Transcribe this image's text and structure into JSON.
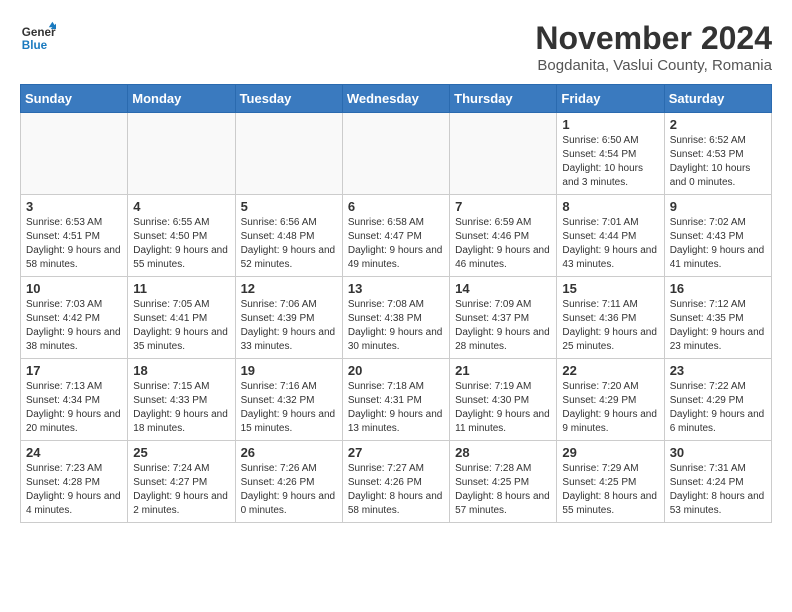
{
  "header": {
    "logo_line1": "General",
    "logo_line2": "Blue",
    "month_title": "November 2024",
    "location": "Bogdanita, Vaslui County, Romania"
  },
  "weekdays": [
    "Sunday",
    "Monday",
    "Tuesday",
    "Wednesday",
    "Thursday",
    "Friday",
    "Saturday"
  ],
  "weeks": [
    [
      {
        "day": "",
        "info": ""
      },
      {
        "day": "",
        "info": ""
      },
      {
        "day": "",
        "info": ""
      },
      {
        "day": "",
        "info": ""
      },
      {
        "day": "",
        "info": ""
      },
      {
        "day": "1",
        "info": "Sunrise: 6:50 AM\nSunset: 4:54 PM\nDaylight: 10 hours and 3 minutes."
      },
      {
        "day": "2",
        "info": "Sunrise: 6:52 AM\nSunset: 4:53 PM\nDaylight: 10 hours and 0 minutes."
      }
    ],
    [
      {
        "day": "3",
        "info": "Sunrise: 6:53 AM\nSunset: 4:51 PM\nDaylight: 9 hours and 58 minutes."
      },
      {
        "day": "4",
        "info": "Sunrise: 6:55 AM\nSunset: 4:50 PM\nDaylight: 9 hours and 55 minutes."
      },
      {
        "day": "5",
        "info": "Sunrise: 6:56 AM\nSunset: 4:48 PM\nDaylight: 9 hours and 52 minutes."
      },
      {
        "day": "6",
        "info": "Sunrise: 6:58 AM\nSunset: 4:47 PM\nDaylight: 9 hours and 49 minutes."
      },
      {
        "day": "7",
        "info": "Sunrise: 6:59 AM\nSunset: 4:46 PM\nDaylight: 9 hours and 46 minutes."
      },
      {
        "day": "8",
        "info": "Sunrise: 7:01 AM\nSunset: 4:44 PM\nDaylight: 9 hours and 43 minutes."
      },
      {
        "day": "9",
        "info": "Sunrise: 7:02 AM\nSunset: 4:43 PM\nDaylight: 9 hours and 41 minutes."
      }
    ],
    [
      {
        "day": "10",
        "info": "Sunrise: 7:03 AM\nSunset: 4:42 PM\nDaylight: 9 hours and 38 minutes."
      },
      {
        "day": "11",
        "info": "Sunrise: 7:05 AM\nSunset: 4:41 PM\nDaylight: 9 hours and 35 minutes."
      },
      {
        "day": "12",
        "info": "Sunrise: 7:06 AM\nSunset: 4:39 PM\nDaylight: 9 hours and 33 minutes."
      },
      {
        "day": "13",
        "info": "Sunrise: 7:08 AM\nSunset: 4:38 PM\nDaylight: 9 hours and 30 minutes."
      },
      {
        "day": "14",
        "info": "Sunrise: 7:09 AM\nSunset: 4:37 PM\nDaylight: 9 hours and 28 minutes."
      },
      {
        "day": "15",
        "info": "Sunrise: 7:11 AM\nSunset: 4:36 PM\nDaylight: 9 hours and 25 minutes."
      },
      {
        "day": "16",
        "info": "Sunrise: 7:12 AM\nSunset: 4:35 PM\nDaylight: 9 hours and 23 minutes."
      }
    ],
    [
      {
        "day": "17",
        "info": "Sunrise: 7:13 AM\nSunset: 4:34 PM\nDaylight: 9 hours and 20 minutes."
      },
      {
        "day": "18",
        "info": "Sunrise: 7:15 AM\nSunset: 4:33 PM\nDaylight: 9 hours and 18 minutes."
      },
      {
        "day": "19",
        "info": "Sunrise: 7:16 AM\nSunset: 4:32 PM\nDaylight: 9 hours and 15 minutes."
      },
      {
        "day": "20",
        "info": "Sunrise: 7:18 AM\nSunset: 4:31 PM\nDaylight: 9 hours and 13 minutes."
      },
      {
        "day": "21",
        "info": "Sunrise: 7:19 AM\nSunset: 4:30 PM\nDaylight: 9 hours and 11 minutes."
      },
      {
        "day": "22",
        "info": "Sunrise: 7:20 AM\nSunset: 4:29 PM\nDaylight: 9 hours and 9 minutes."
      },
      {
        "day": "23",
        "info": "Sunrise: 7:22 AM\nSunset: 4:29 PM\nDaylight: 9 hours and 6 minutes."
      }
    ],
    [
      {
        "day": "24",
        "info": "Sunrise: 7:23 AM\nSunset: 4:28 PM\nDaylight: 9 hours and 4 minutes."
      },
      {
        "day": "25",
        "info": "Sunrise: 7:24 AM\nSunset: 4:27 PM\nDaylight: 9 hours and 2 minutes."
      },
      {
        "day": "26",
        "info": "Sunrise: 7:26 AM\nSunset: 4:26 PM\nDaylight: 9 hours and 0 minutes."
      },
      {
        "day": "27",
        "info": "Sunrise: 7:27 AM\nSunset: 4:26 PM\nDaylight: 8 hours and 58 minutes."
      },
      {
        "day": "28",
        "info": "Sunrise: 7:28 AM\nSunset: 4:25 PM\nDaylight: 8 hours and 57 minutes."
      },
      {
        "day": "29",
        "info": "Sunrise: 7:29 AM\nSunset: 4:25 PM\nDaylight: 8 hours and 55 minutes."
      },
      {
        "day": "30",
        "info": "Sunrise: 7:31 AM\nSunset: 4:24 PM\nDaylight: 8 hours and 53 minutes."
      }
    ]
  ]
}
